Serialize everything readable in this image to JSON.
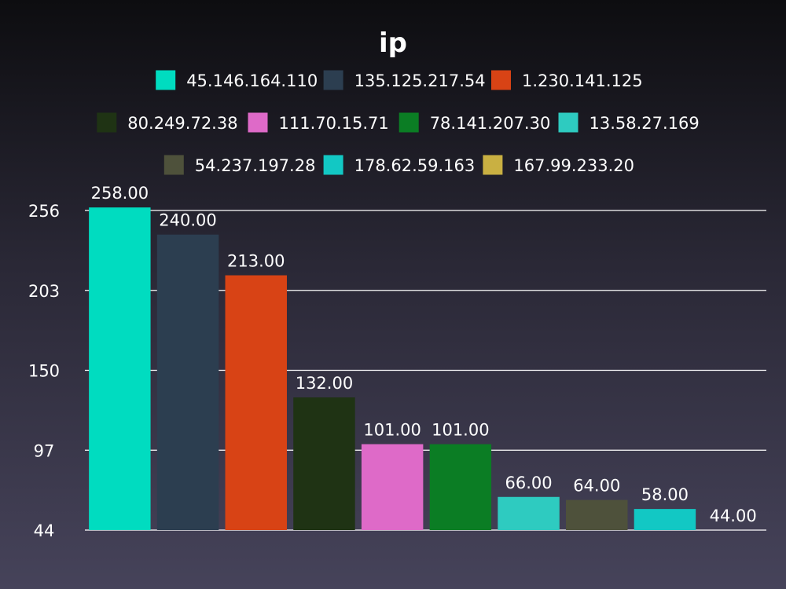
{
  "chart_data": {
    "type": "bar",
    "title": "ip",
    "categories": [
      "45.146.164.110",
      "135.125.217.54",
      "1.230.141.125",
      "80.249.72.38",
      "111.70.15.71",
      "78.141.207.30",
      "13.58.27.169",
      "54.237.197.28",
      "178.62.59.163",
      "167.99.233.20"
    ],
    "values": [
      258,
      240,
      213,
      132,
      101,
      101,
      66,
      64,
      58,
      44
    ],
    "value_labels": [
      "258.00",
      "240.00",
      "213.00",
      "132.00",
      "101.00",
      "101.00",
      "66.00",
      "64.00",
      "58.00",
      "44.00"
    ],
    "colors": [
      "#00dcc0",
      "#2c3e50",
      "#d84315",
      "#1f3314",
      "#de6ac8",
      "#0b7d24",
      "#2ecbc0",
      "#4e513b",
      "#12c8c4",
      "#c9b042"
    ],
    "yticks": [
      44,
      97,
      150,
      203,
      256
    ],
    "ylim": [
      44,
      256
    ],
    "grid": true,
    "legend_position": "top",
    "xlabel": "",
    "ylabel": ""
  }
}
